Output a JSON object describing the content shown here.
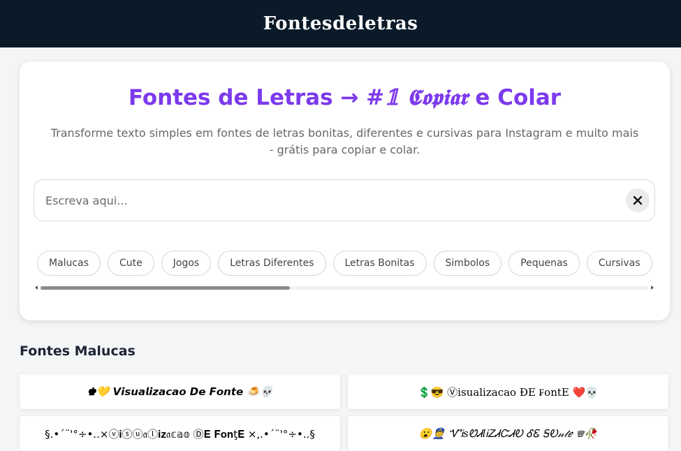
{
  "header": {
    "brand": "Fontesdeletras"
  },
  "hero": {
    "title_plain": "Fontes de Letras → ",
    "title_fancy": "#𝟙 𝕮𝖔𝖕𝖎𝖆𝖗",
    "title_end": " e Colar",
    "subtitle": "Transforme texto simples em fontes de letras bonitas, diferentes e cursivas para Instagram e muito mais - grátis para copiar e colar."
  },
  "search": {
    "placeholder": "Escreva aqui...",
    "value": ""
  },
  "categories": [
    "Malucas",
    "Cute",
    "Jogos",
    "Letras Diferentes",
    "Letras Bonitas",
    "Simbolos",
    "Pequenas",
    "Cursivas"
  ],
  "scrollbar": {
    "position_fraction": 0.41
  },
  "section": {
    "title": "Fontes Malucas"
  },
  "previews": [
    "♚💛 𝙑𝙞𝙨𝙪𝙖𝙡𝙞𝙯𝙖𝙘𝙖𝙤 𝘿𝙚 𝙁𝙤𝙣𝙩𝙚 🍮💀",
    "💲😎 Ⓥisualizacao ĐE ₣ontE ❤️💀",
    "§.•´¨'°÷•..×ⓥ𝐢ⓢⓤ𝔞ⓛ𝐢𝐳𝔞𝕔𝕒𝕠 Ⓓ𝐄 𝐅𝐨𝐧ţ𝐄 ×,.•´¨'°÷•..§",
    "😮👮 ᏉᎥsᏬᏗlᎥᏃᏗᏨᏗᎧ ᎴᏋ ᎦᎧ𝓃𝓉ℯ ♕🥀"
  ]
}
